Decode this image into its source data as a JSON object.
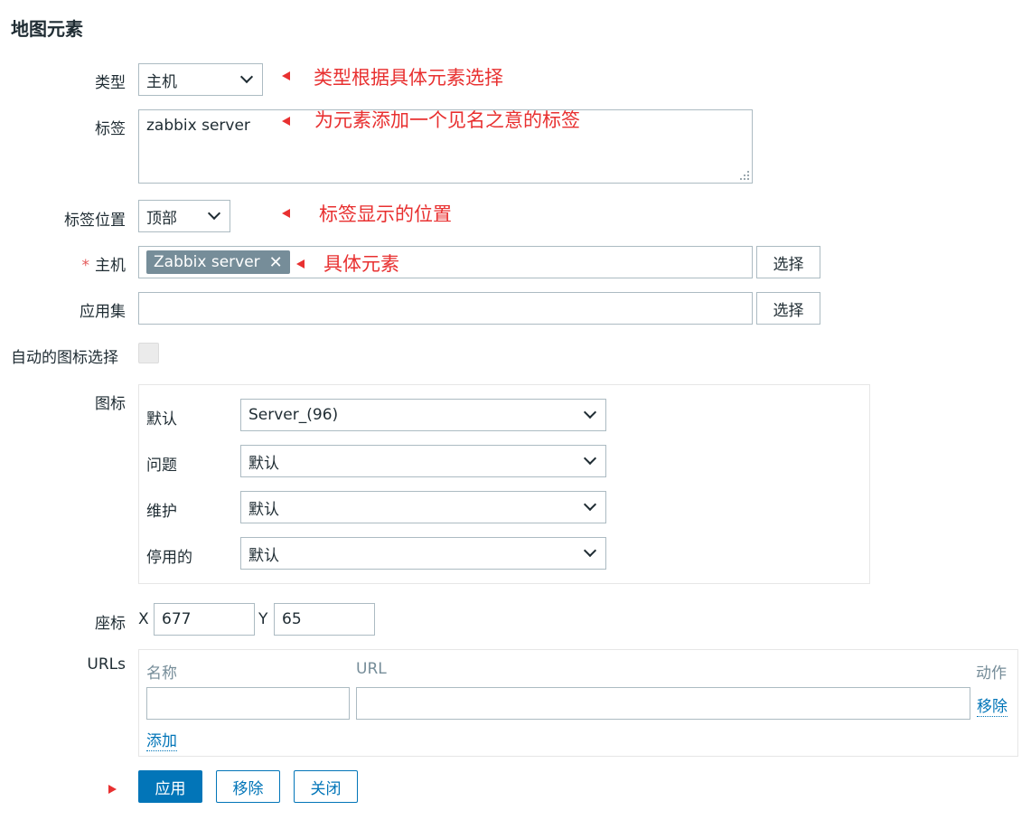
{
  "page_title": "地图元素",
  "fields": {
    "type": {
      "label": "类型",
      "value": "主机",
      "annotation": "类型根据具体元素选择"
    },
    "label": {
      "label": "标签",
      "value": "zabbix server",
      "annotation": "为元素添加一个见名之意的标签"
    },
    "label_location": {
      "label": "标签位置",
      "value": "顶部",
      "annotation": "标签显示的位置"
    },
    "host": {
      "label": "主机",
      "required_mark": "*",
      "tag": "Zabbix server",
      "tag_remove": "✕",
      "annotation": "具体元素",
      "select_label": "选择"
    },
    "application": {
      "label": "应用集",
      "value": "",
      "select_label": "选择"
    },
    "auto_icon": {
      "label": "自动的图标选择",
      "checked": false
    }
  },
  "icons": {
    "label": "图标",
    "rows": [
      {
        "label": "默认",
        "value": "Server_(96)"
      },
      {
        "label": "问题",
        "value": "默认"
      },
      {
        "label": "维护",
        "value": "默认"
      },
      {
        "label": "停用的",
        "value": "默认"
      }
    ]
  },
  "coordinates": {
    "label": "座标",
    "x_label": "X",
    "x_value": "677",
    "y_label": "Y",
    "y_value": "65"
  },
  "urls": {
    "label": "URLs",
    "col_name": "名称",
    "col_url": "URL",
    "col_action": "动作",
    "row": {
      "name": "",
      "url": "",
      "remove": "移除"
    },
    "add": "添加"
  },
  "buttons": {
    "apply": "应用",
    "remove": "移除",
    "close": "关闭"
  },
  "colors": {
    "primary": "#0275b8",
    "annotation": "#e83030",
    "tag_bg": "#768d99",
    "required": "#e45959"
  }
}
